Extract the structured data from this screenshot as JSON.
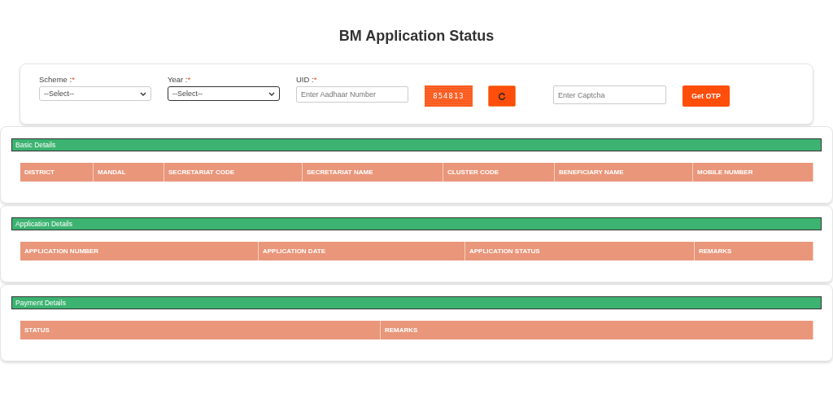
{
  "title": "BM Application Status",
  "form": {
    "fields": [
      {
        "kind": "select",
        "label": "Scheme :",
        "required_mark": "*",
        "value": "--Select--",
        "focused": false
      },
      {
        "kind": "select",
        "label": "Year :",
        "required_mark": "*",
        "value": "--Select--",
        "focused": true
      },
      {
        "kind": "input",
        "label": "UID :",
        "required_mark": "*",
        "placeholder": "Enter Aadhaar Number",
        "focused": false
      }
    ],
    "captcha": "854813",
    "captcha_placeholder": "Enter Captcha",
    "submit": "Get OTP"
  },
  "sections": [
    {
      "title": "Basic Details",
      "columns": [
        "DISTRICT",
        "MANDAL",
        "SECRETARIAT CODE",
        "SECRETARIAT NAME",
        "CLUSTER CODE",
        "BENEFICIARY NAME",
        "MOBILE NUMBER"
      ]
    },
    {
      "title": "Application Details",
      "columns": [
        "APPLICATION NUMBER",
        "APPLICATION DATE",
        "APPLICATION STATUS",
        "REMARKS"
      ]
    },
    {
      "title": "Payment Details",
      "columns": [
        "STATUS",
        "REMARKS"
      ]
    }
  ]
}
